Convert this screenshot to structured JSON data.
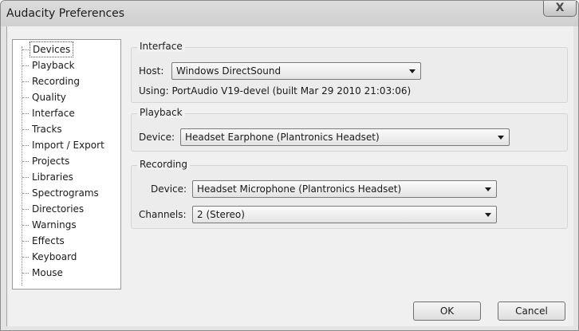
{
  "window": {
    "title": "Audacity Preferences",
    "close_glyph": "X"
  },
  "sidebar": {
    "items": [
      {
        "label": "Devices"
      },
      {
        "label": "Playback"
      },
      {
        "label": "Recording"
      },
      {
        "label": "Quality"
      },
      {
        "label": "Interface"
      },
      {
        "label": "Tracks"
      },
      {
        "label": "Import / Export"
      },
      {
        "label": "Projects"
      },
      {
        "label": "Libraries"
      },
      {
        "label": "Spectrograms"
      },
      {
        "label": "Directories"
      },
      {
        "label": "Warnings"
      },
      {
        "label": "Effects"
      },
      {
        "label": "Keyboard"
      },
      {
        "label": "Mouse"
      }
    ],
    "selected": "Devices"
  },
  "interface_group": {
    "title": "Interface",
    "host_label": "Host:",
    "host_value": "Windows DirectSound",
    "using_text": "Using: PortAudio V19-devel (built Mar 29 2010 21:03:06)"
  },
  "playback_group": {
    "title": "Playback",
    "device_label": "Device:",
    "device_value": "Headset Earphone (Plantronics Headset)"
  },
  "recording_group": {
    "title": "Recording",
    "device_label": "Device:",
    "device_value": "Headset Microphone (Plantronics Headset)",
    "channels_label": "Channels:",
    "channels_value": "2 (Stereo)"
  },
  "buttons": {
    "ok": "OK",
    "cancel": "Cancel"
  }
}
